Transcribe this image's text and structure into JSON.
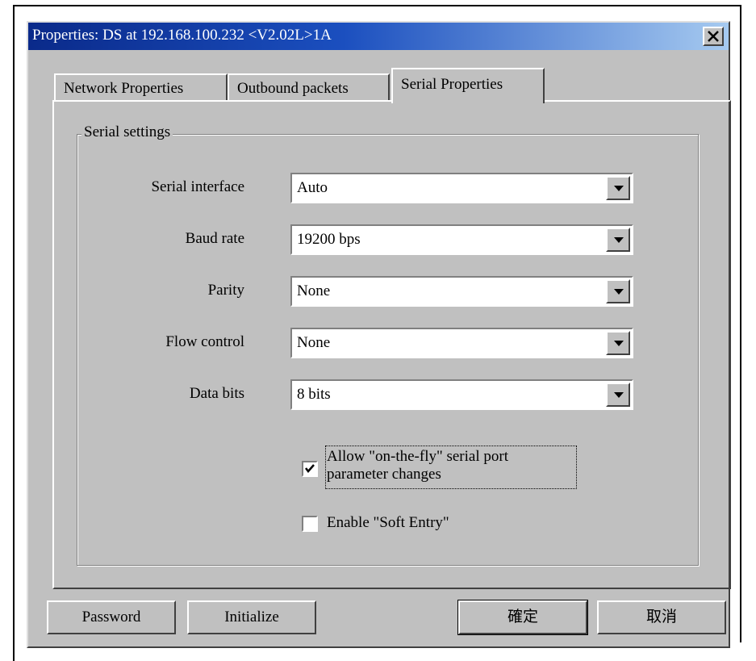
{
  "window": {
    "title": "Properties: DS at 192.168.100.232 <V2.02L>1A"
  },
  "tabs": [
    {
      "label": "Network Properties",
      "active": false
    },
    {
      "label": "Outbound packets",
      "active": false
    },
    {
      "label": "Serial Properties",
      "active": true
    }
  ],
  "serial_settings": {
    "group_label": "Serial settings",
    "fields": [
      {
        "label": "Serial interface",
        "value": "Auto"
      },
      {
        "label": "Baud rate",
        "value": "19200 bps"
      },
      {
        "label": "Parity",
        "value": "None"
      },
      {
        "label": "Flow control",
        "value": "None"
      },
      {
        "label": "Data bits",
        "value": "8 bits"
      }
    ],
    "checkboxes": [
      {
        "line1": "Allow \"on-the-fly\" serial port",
        "line2": "parameter changes",
        "checked": true
      },
      {
        "line1": "Enable \"Soft Entry\"",
        "line2": "",
        "checked": false
      }
    ]
  },
  "buttons": {
    "password": "Password",
    "initialize": "Initialize",
    "ok": "確定",
    "cancel": "取消"
  },
  "colors": {
    "face": "#c0c0c0",
    "title_start": "#0a2a8a",
    "title_end": "#a6caf0"
  },
  "icons": {
    "close": "close-icon",
    "dropdown": "chevron-down-icon",
    "check": "check-icon"
  }
}
